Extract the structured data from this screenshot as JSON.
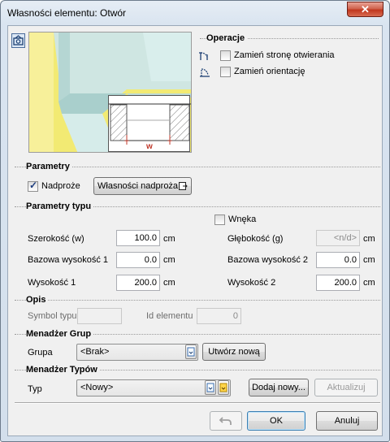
{
  "window": {
    "title": "Własności elementu: Otwór",
    "close_label": "✕"
  },
  "operations": {
    "title": "Operacje",
    "swap_opening_side": "Zamień stronę otwierania",
    "swap_orientation": "Zamień orientację"
  },
  "preview": {
    "dimension_label": "w"
  },
  "params": {
    "title": "Parametry",
    "lintel_label": "Nadproże",
    "lintel_checked": true,
    "lintel_props_button": "Własności nadproża"
  },
  "type_params": {
    "title": "Parametry typu",
    "niche_label": "Wnęka",
    "width_label": "Szerokość (w)",
    "width_value": "100.0",
    "width_unit": "cm",
    "depth_label": "Głębokość (g)",
    "depth_value": "<n/d>",
    "depth_unit": "cm",
    "base_height1_label": "Bazowa wysokość 1",
    "base_height1_value": "0.0",
    "base_height1_unit": "cm",
    "base_height2_label": "Bazowa wysokość 2",
    "base_height2_value": "0.0",
    "base_height2_unit": "cm",
    "height1_label": "Wysokość 1",
    "height1_value": "200.0",
    "height1_unit": "cm",
    "height2_label": "Wysokość 2",
    "height2_value": "200.0",
    "height2_unit": "cm"
  },
  "description": {
    "title": "Opis",
    "type_symbol_label": "Symbol typu",
    "type_symbol_value": "",
    "element_id_label": "Id elementu",
    "element_id_value": "0"
  },
  "group_manager": {
    "title": "Menadżer Grup",
    "group_label": "Grupa",
    "group_value": "<Brak>",
    "create_button": "Utwórz nową"
  },
  "type_manager": {
    "title": "Menadżer Typów",
    "type_label": "Typ",
    "type_value": "<Nowy>",
    "add_button": "Dodaj nowy...",
    "update_button": "Aktualizuj"
  },
  "footer": {
    "ok": "OK",
    "cancel": "Anuluj"
  }
}
